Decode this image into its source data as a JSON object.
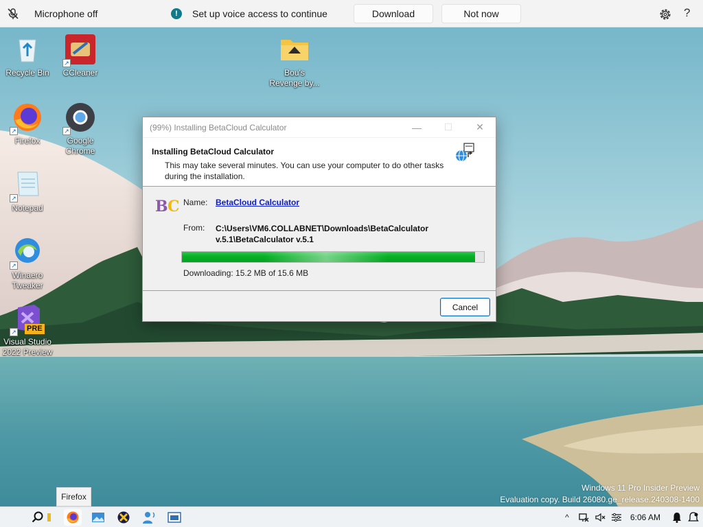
{
  "voice_bar": {
    "mic_status": "Microphone off",
    "message": "Set up voice access to continue",
    "download_label": "Download",
    "not_now_label": "Not now",
    "help_label": "?",
    "info_glyph": "!"
  },
  "desktop_icons": [
    {
      "name": "Recycle Bin",
      "icon": "recycle-bin-icon"
    },
    {
      "name": "CCleaner",
      "icon": "ccleaner-icon"
    },
    {
      "name": "Bou's Revenge by...",
      "icon": "folder-icon"
    },
    {
      "name": "Firefox",
      "icon": "firefox-icon"
    },
    {
      "name": "Google Chrome",
      "icon": "chrome-icon"
    },
    {
      "name": "Notepad",
      "icon": "notepad-icon"
    },
    {
      "name": "Winaero Tweaker",
      "icon": "winaero-icon"
    },
    {
      "name": "Visual Studio 2022 Preview",
      "icon": "visual-studio-icon",
      "badge": "PRE"
    }
  ],
  "dialog": {
    "title": "(99%) Installing BetaCloud Calculator",
    "heading": "Installing BetaCloud Calculator",
    "description": "This may take several minutes. You can use your computer to do other tasks during the installation.",
    "logo_text_b": "B",
    "logo_text_c": "C",
    "name_label": "Name:",
    "name_value": "BetaCloud Calculator",
    "from_label": "From:",
    "from_value": "C:\\Users\\VM6.COLLABNET\\Downloads\\BetaCalculator v.5.1\\BetaCalculator v.5.1",
    "progress": 0.97,
    "status": "Downloading: 15.2 MB of 15.6 MB",
    "cancel_label": "Cancel",
    "minimize_glyph": "—",
    "maximize_glyph": "☐",
    "close_glyph": "✕"
  },
  "watermark": {
    "line1": "Windows 11 Pro Insider Preview",
    "line2": "Evaluation copy. Build 26080.ge_release.240308-1400"
  },
  "taskbar": {
    "tooltip": "Firefox",
    "clock": "6:06 AM",
    "tray_chevron": "^",
    "accent": "#0067c0",
    "progress_green": "#06b025"
  }
}
